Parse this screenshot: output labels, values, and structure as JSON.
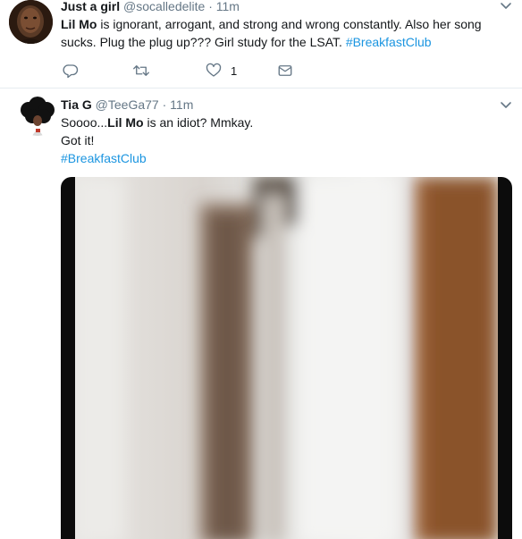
{
  "tweets": [
    {
      "name": "Just a girl",
      "handle": "@socalledelite",
      "separator": "·",
      "time": "11m",
      "text_line1_bold": "Lil Mo",
      "text_line1_rest": " is ignorant, arrogant, and strong and wrong constantly. Also her song",
      "text_line2": "sucks. Plug the plug up??? Girl study for the LSAT. ",
      "hashtag": "#BreakfastClub",
      "like_count": "1"
    },
    {
      "name": "Tia G",
      "handle": "@TeeGa77",
      "separator": "·",
      "time": "11m",
      "text_line1_pre": "Soooo...",
      "text_line1_bold": "Lil Mo",
      "text_line1_rest": " is an idiot? Mmkay.",
      "text_line2": "Got it!",
      "hashtag": "#BreakfastClub"
    }
  ],
  "icons": {
    "reply": "reply-icon",
    "retweet": "retweet-icon",
    "like": "heart-icon",
    "dm": "envelope-icon",
    "caret": "chevron-down-icon"
  },
  "colors": {
    "text": "#14171a",
    "secondary": "#657786",
    "link": "#1b95e0",
    "divider": "#e6ecf0"
  }
}
